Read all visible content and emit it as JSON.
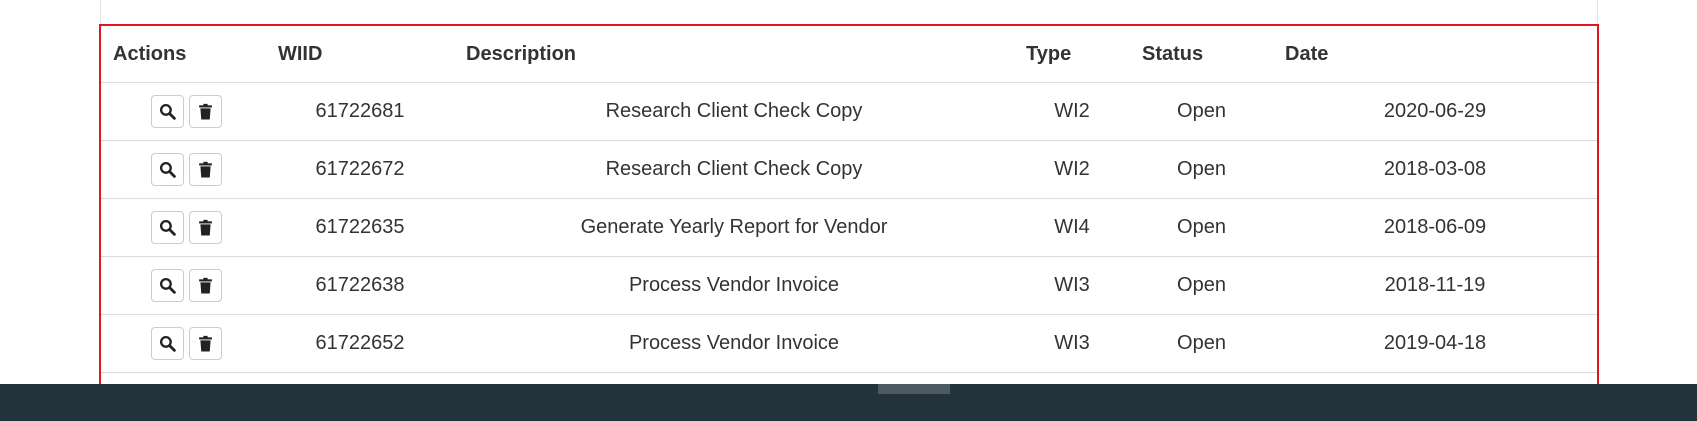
{
  "table": {
    "headers": {
      "actions": "Actions",
      "wiid": "WIID",
      "description": "Description",
      "type": "Type",
      "status": "Status",
      "date": "Date"
    },
    "rows": [
      {
        "wiid": "61722681",
        "description": "Research Client Check Copy",
        "type": "WI2",
        "status": "Open",
        "date": "2020-06-29"
      },
      {
        "wiid": "61722672",
        "description": "Research Client Check Copy",
        "type": "WI2",
        "status": "Open",
        "date": "2018-03-08"
      },
      {
        "wiid": "61722635",
        "description": "Generate Yearly Report for Vendor",
        "type": "WI4",
        "status": "Open",
        "date": "2018-06-09"
      },
      {
        "wiid": "61722638",
        "description": "Process Vendor Invoice",
        "type": "WI3",
        "status": "Open",
        "date": "2018-11-19"
      },
      {
        "wiid": "61722652",
        "description": "Process Vendor Invoice",
        "type": "WI3",
        "status": "Open",
        "date": "2019-04-18"
      }
    ],
    "row_actions": {
      "view_icon": "search-icon",
      "delete_icon": "trash-icon"
    },
    "highlight_color": "#e0161e"
  },
  "bottom_bar": {
    "color": "#23333b"
  }
}
